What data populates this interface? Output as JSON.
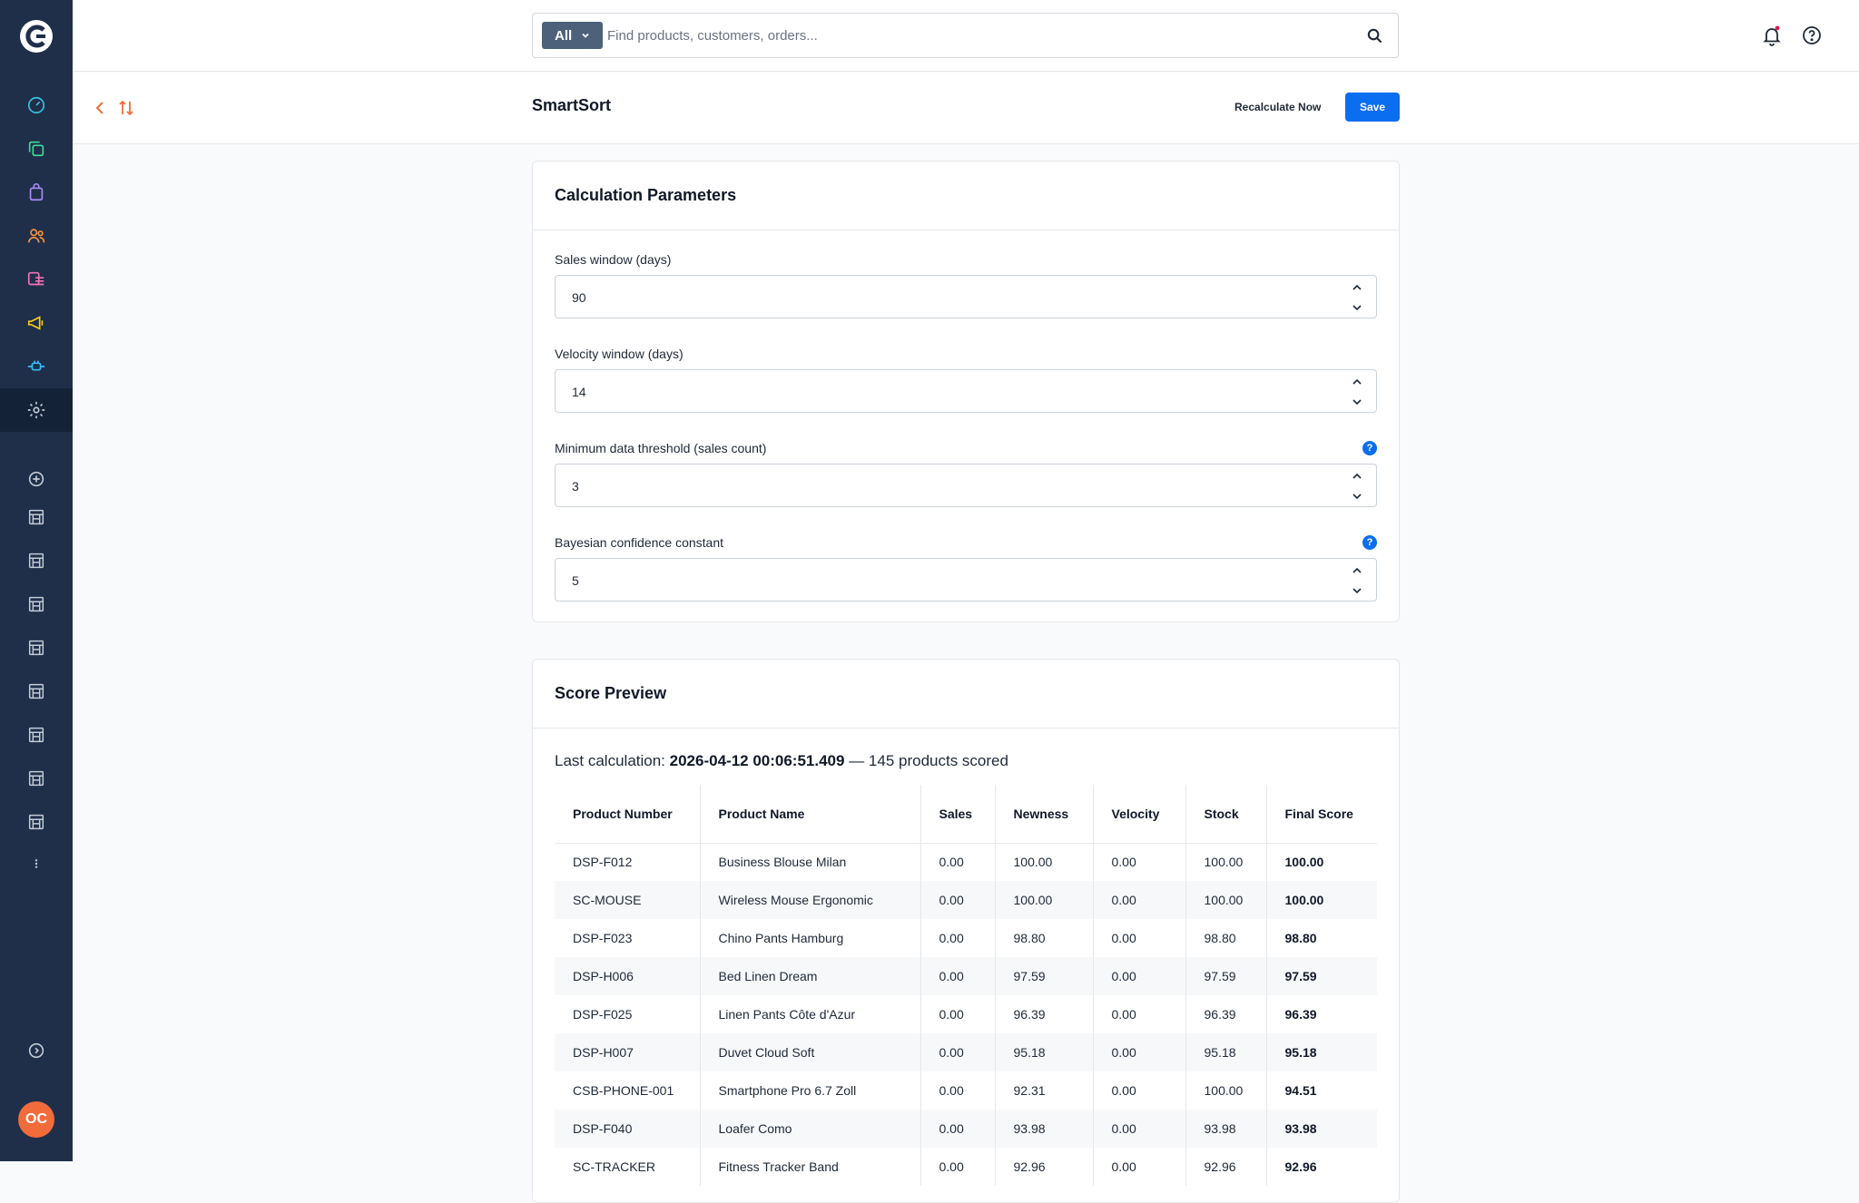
{
  "user": {
    "initials": "OC"
  },
  "search": {
    "type_label": "All",
    "placeholder": "Find products, customers, orders..."
  },
  "header": {
    "title": "SmartSort",
    "recalculate_label": "Recalculate Now",
    "save_label": "Save"
  },
  "params": {
    "title": "Calculation Parameters",
    "fields": [
      {
        "label": "Sales window (days)",
        "value": "90"
      },
      {
        "label": "Velocity window (days)",
        "value": "14"
      },
      {
        "label": "Minimum data threshold (sales count)",
        "value": "3",
        "help": "?"
      },
      {
        "label": "Bayesian confidence constant",
        "value": "5",
        "help": "?"
      }
    ]
  },
  "preview": {
    "title": "Score Preview",
    "last_calc_prefix": "Last calculation: ",
    "last_calc_time": "2026-04-12 00:06:51.409",
    "last_calc_suffix": " — 145 products scored",
    "columns": [
      "Product Number",
      "Product Name",
      "Sales",
      "Newness",
      "Velocity",
      "Stock",
      "Final Score"
    ],
    "rows": [
      [
        "DSP-F012",
        "Business Blouse Milan",
        "0.00",
        "100.00",
        "0.00",
        "100.00",
        "100.00"
      ],
      [
        "SC-MOUSE",
        "Wireless Mouse Ergonomic",
        "0.00",
        "100.00",
        "0.00",
        "100.00",
        "100.00"
      ],
      [
        "DSP-F023",
        "Chino Pants Hamburg",
        "0.00",
        "98.80",
        "0.00",
        "98.80",
        "98.80"
      ],
      [
        "DSP-H006",
        "Bed Linen Dream",
        "0.00",
        "97.59",
        "0.00",
        "97.59",
        "97.59"
      ],
      [
        "DSP-F025",
        "Linen Pants Côte d'Azur",
        "0.00",
        "96.39",
        "0.00",
        "96.39",
        "96.39"
      ],
      [
        "DSP-H007",
        "Duvet Cloud Soft",
        "0.00",
        "95.18",
        "0.00",
        "95.18",
        "95.18"
      ],
      [
        "CSB-PHONE-001",
        "Smartphone Pro 6.7 Zoll",
        "0.00",
        "92.31",
        "0.00",
        "100.00",
        "94.51"
      ],
      [
        "DSP-F040",
        "Loafer Como",
        "0.00",
        "93.98",
        "0.00",
        "93.98",
        "93.98"
      ],
      [
        "SC-TRACKER",
        "Fitness Tracker Band",
        "0.00",
        "92.96",
        "0.00",
        "92.96",
        "92.96"
      ]
    ]
  },
  "colors": {
    "sidebar": "#1f2f4a",
    "primary": "#0b6ef0",
    "accent": "#f26b3a"
  }
}
